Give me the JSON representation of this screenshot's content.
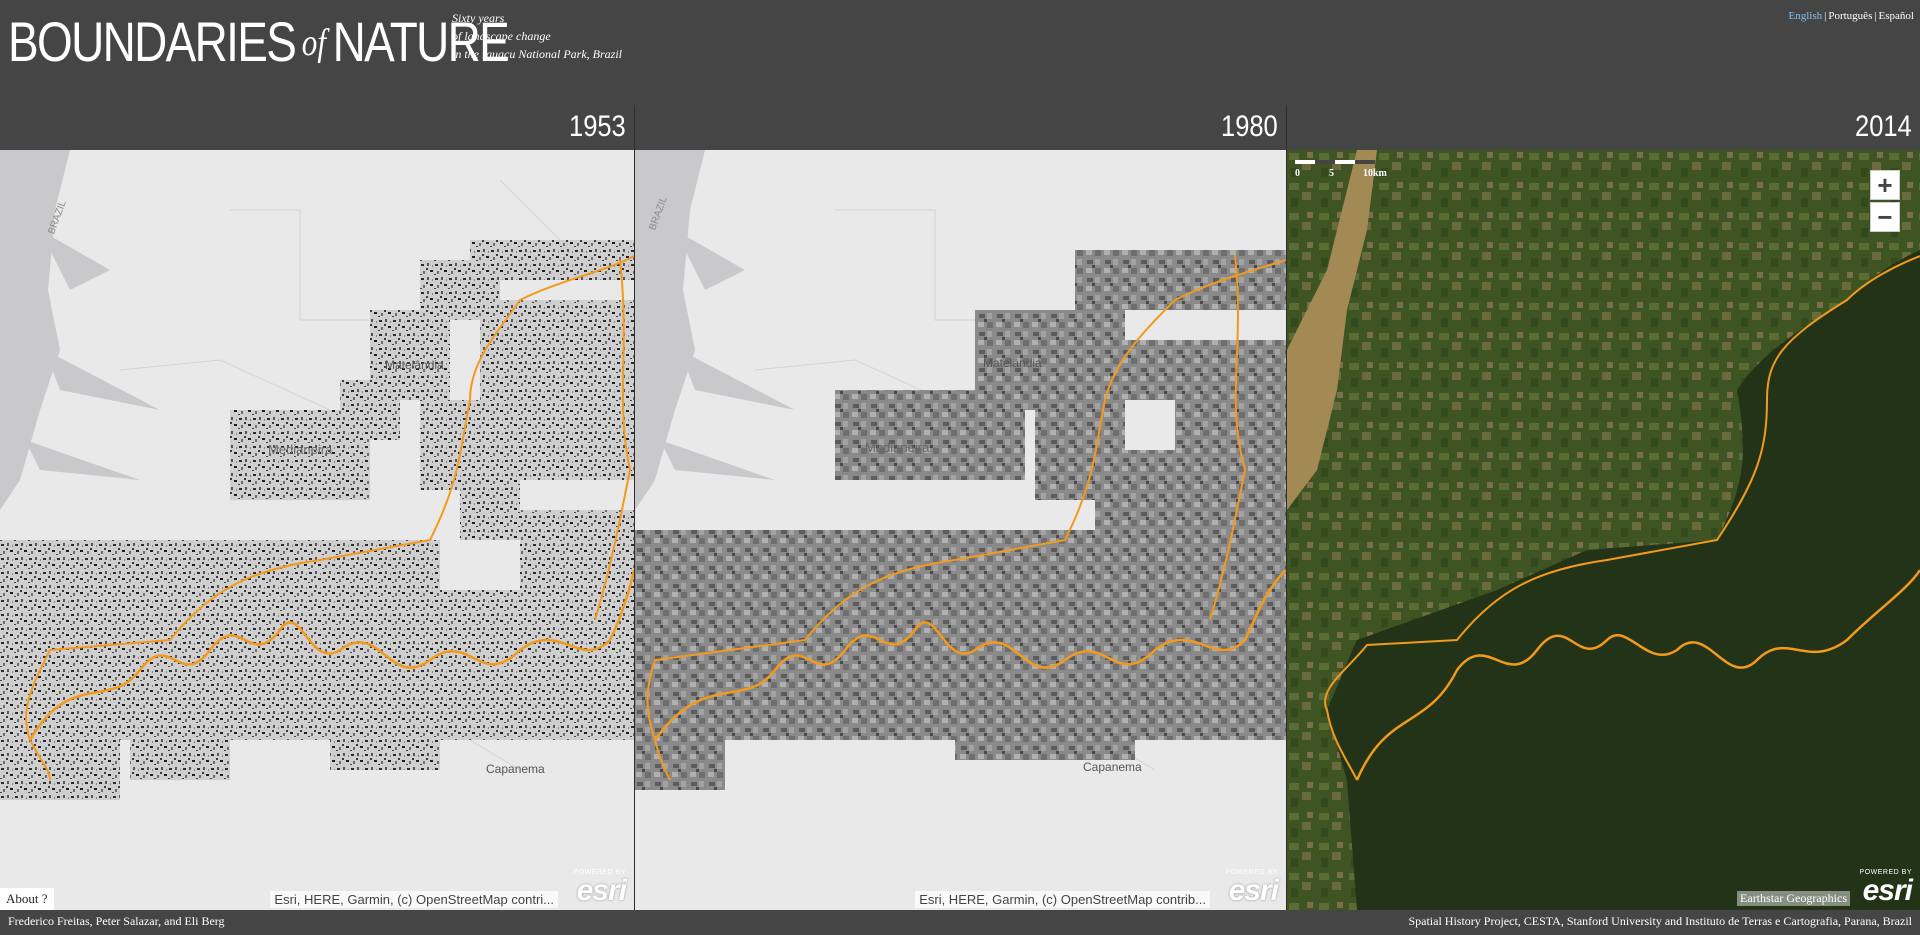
{
  "header": {
    "title_part1": "BOUNDARIES",
    "title_of": "of",
    "title_part2": "NATURE",
    "subtitle_lines": [
      "Sixty years",
      "of landscape change",
      "in the Iguaçu National Park, Brazil"
    ],
    "languages": [
      {
        "label": "English",
        "active": true
      },
      {
        "label": "Português",
        "active": false
      },
      {
        "label": "Español",
        "active": false
      }
    ],
    "lang_separator": "|"
  },
  "panels": [
    {
      "year": "1953",
      "basemap": "light-gray",
      "attribution": "Esri, HERE, Garmin, (c) OpenStreetMap contri..."
    },
    {
      "year": "1980",
      "basemap": "light-gray",
      "attribution": "Esri, HERE, Garmin, (c) OpenStreetMap contrib..."
    },
    {
      "year": "2014",
      "basemap": "satellite",
      "attribution": "Earthstar Geographics"
    }
  ],
  "map_labels": {
    "medianeira": "Medianeira",
    "matelandia": "Matelândia",
    "capanema": "Capanema",
    "brazil": "BRAZIL"
  },
  "esri": {
    "powered_by": "POWERED BY",
    "name": "esri"
  },
  "scale_bar": {
    "labels": [
      "0",
      "5",
      "10km"
    ]
  },
  "zoom": {
    "in": "+",
    "out": "−"
  },
  "about_button": "About ?",
  "footer": {
    "left": "Frederico Freitas, Peter Salazar, and Eli Berg",
    "right": "Spatial History Project, CESTA, Stanford University and Instituto de Terras e Cartografia, Parana, Brazil"
  },
  "colors": {
    "header_bg": "#454545",
    "boundary": "#f39a1c",
    "basemap": "#e9e9e9",
    "forest": "#2f3f1e",
    "active_language": "#7fc1f0"
  }
}
